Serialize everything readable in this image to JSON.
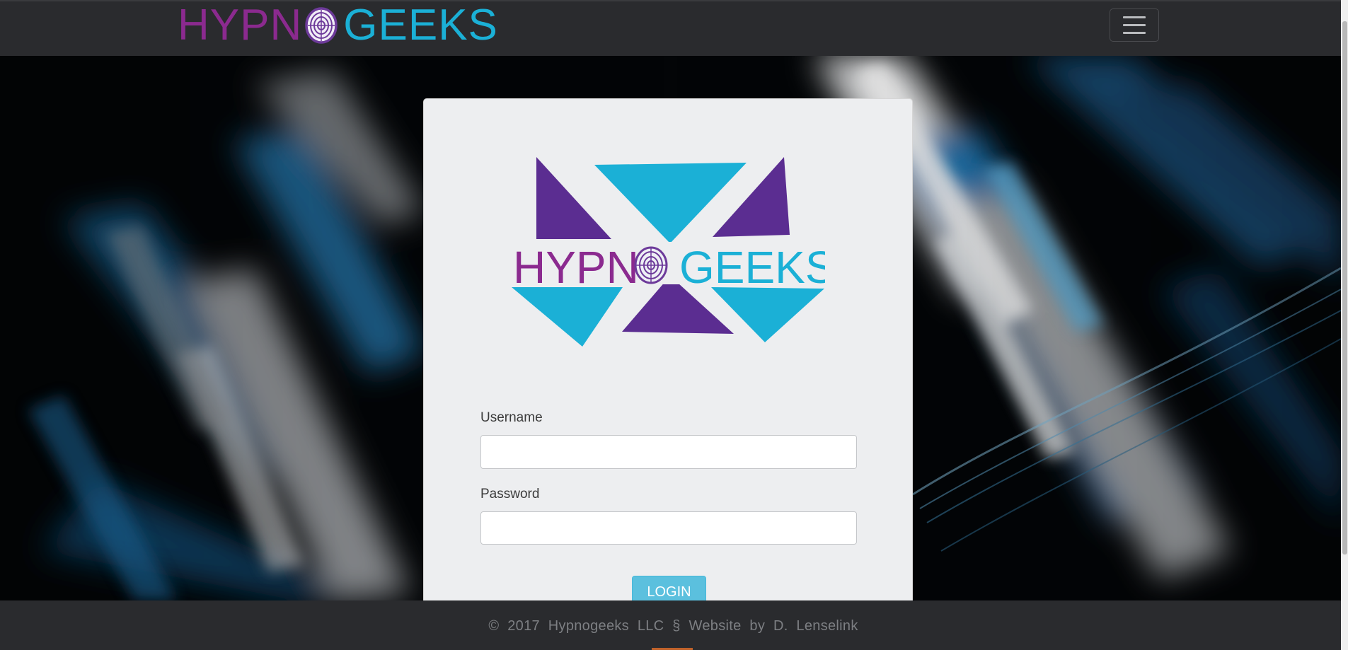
{
  "brand": {
    "left_text": "HYPN",
    "right_text": "GEEKS"
  },
  "header": {
    "menu_toggle": "hamburger-menu-icon"
  },
  "logo": {
    "left_text": "HYPN",
    "right_text": "GEEKS"
  },
  "login_form": {
    "username_label": "Username",
    "username_value": "",
    "password_label": "Password",
    "password_value": "",
    "login_label": "LOGIN"
  },
  "footer": {
    "text": "© 2017 Hypnogeeks LLC § Website by D. Lenselink"
  },
  "colors": {
    "brand_purple": "#8b2a8f",
    "brand_cyan": "#1bb0d6",
    "triangle_purple": "#5b2d91",
    "button": "#5bc0de",
    "bar": "#2a2b2e"
  }
}
